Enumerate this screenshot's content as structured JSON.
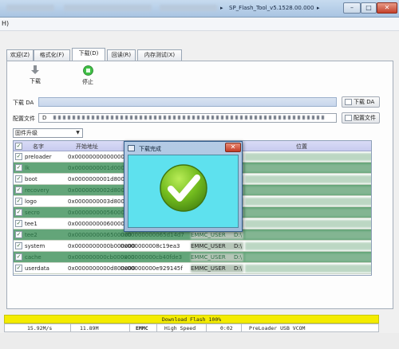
{
  "window": {
    "title": "SP_Flash_Tool_v5.1528.00.000",
    "btn_min": "–",
    "btn_max": "□",
    "btn_close": "✕"
  },
  "menu": {
    "help_letter": "H)"
  },
  "tabs": [
    {
      "label": "欢迎(Z)"
    },
    {
      "label": "格式化(F)"
    },
    {
      "label": "下载(D)"
    },
    {
      "label": "回读(R)"
    },
    {
      "label": "内存测试(X)"
    }
  ],
  "toolbar": {
    "download_label": "下载",
    "stop_label": "停止"
  },
  "download_agent": {
    "label": "下载 DA",
    "button": "下载 DA"
  },
  "scatter": {
    "label": "配置文件",
    "value_prefix": "D",
    "button": "配置文件"
  },
  "mode_select": {
    "value": "固件升级"
  },
  "table": {
    "headers": [
      "名字",
      "开始地址",
      "位置"
    ],
    "rows": [
      {
        "name": "preloader",
        "start": "0x0000000000000000",
        "end": "",
        "region": "",
        "location": "",
        "alt": false
      },
      {
        "name": "lk",
        "start": "0x0000000001d00000",
        "end": "",
        "region": "",
        "location": "",
        "alt": true
      },
      {
        "name": "boot",
        "start": "0x0000000001d80000",
        "end": "",
        "region": "",
        "location": "",
        "alt": false
      },
      {
        "name": "recovery",
        "start": "0x0000000002d80000",
        "end": "",
        "region": "",
        "location": "",
        "alt": true
      },
      {
        "name": "logo",
        "start": "0x0000000003d80000",
        "end": "",
        "region": "",
        "location": "",
        "alt": false
      },
      {
        "name": "secro",
        "start": "0x0000000005600000",
        "end": "",
        "region": "",
        "location": "",
        "alt": true
      },
      {
        "name": "tee1",
        "start": "0x0000000006000000",
        "end": "",
        "region": "",
        "location": "",
        "alt": false
      },
      {
        "name": "tee2",
        "start": "0x0000000006500000",
        "end": "0x00000000065d14d7",
        "region": "EMMC_USER",
        "location": "D:\\",
        "alt": true
      },
      {
        "name": "system",
        "start": "0x0000000000b000000",
        "end": "0x000000008c19ea3",
        "region": "EMMC_USER",
        "location": "D:\\",
        "alt": false
      },
      {
        "name": "cache",
        "start": "0x000000000cb000000",
        "end": "0x00000000cb40fde3",
        "region": "EMMC_USER",
        "location": "D:\\",
        "alt": true
      },
      {
        "name": "userdata",
        "start": "0x0000000000d8000000",
        "end": "0x00000000e929145f",
        "region": "EMMC_USER",
        "location": "D:\\",
        "alt": false
      }
    ]
  },
  "dialog": {
    "title": "下载完成",
    "close": "✕"
  },
  "progress": {
    "text": "Download Flash 100%",
    "percent": 100
  },
  "status": {
    "speed": "15.92M/s",
    "size": "11.89M",
    "storage": "EMMC",
    "usb_speed": "High Speed",
    "time": "0:02",
    "port": "PreLoader USB VCOM"
  },
  "colors": {
    "row_alt": "#63a579",
    "dialog_body": "#5ee1ee",
    "progress": "#f4ec00",
    "check_green": "#6fb51f"
  }
}
